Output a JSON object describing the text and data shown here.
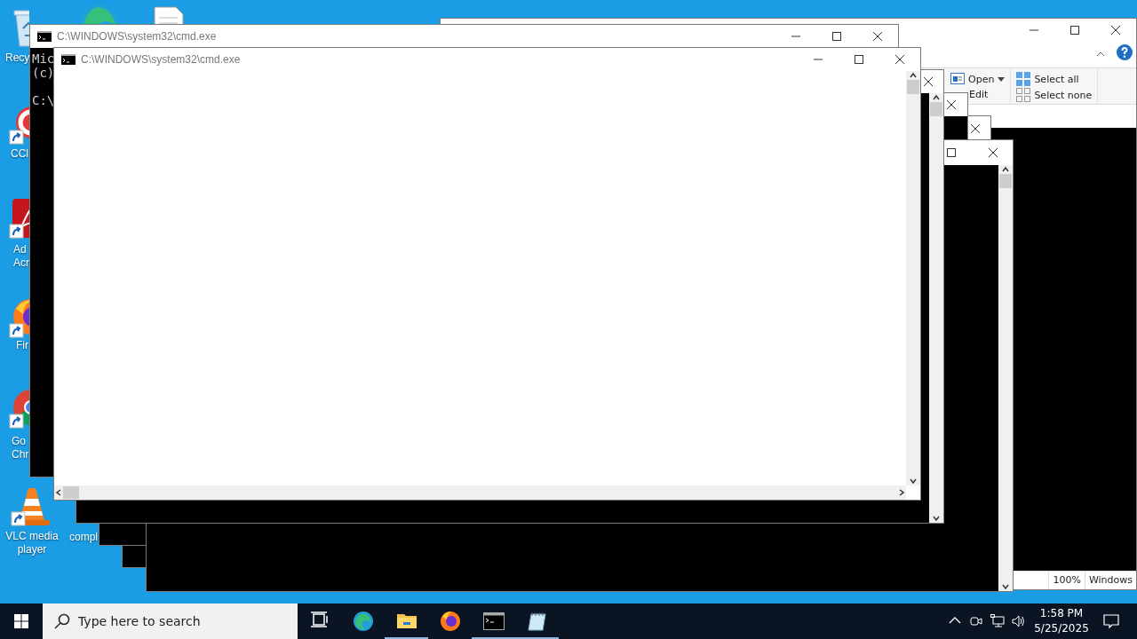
{
  "desktop": {
    "icons": [
      {
        "kind": "recycle",
        "shortcut": false,
        "lines": [
          "Recy"
        ]
      },
      {
        "kind": "edge"
      },
      {
        "kind": "document"
      },
      {
        "kind": "ccleaner",
        "shortcut": true,
        "lines": [
          "CCl"
        ]
      },
      {
        "kind": "acrobat",
        "shortcut": true,
        "lines": [
          "Ad",
          "Acr"
        ]
      },
      {
        "kind": "firefox",
        "shortcut": true,
        "lines": [
          "Fir"
        ]
      },
      {
        "kind": "chrome",
        "shortcut": true,
        "lines": [
          "Go",
          "Chr"
        ]
      },
      {
        "kind": "vlc",
        "shortcut": true,
        "lines": [
          "VLC media",
          "player"
        ]
      },
      {
        "kind": "label",
        "lines": [
          "compl"
        ]
      }
    ]
  },
  "windows": [
    {
      "kind": "explorer",
      "controls": [
        {
          "kind": "minimize"
        },
        {
          "kind": "maximize"
        },
        {
          "kind": "close"
        }
      ],
      "ribbon": [
        {
          "kind": "open",
          "label": "Open",
          "dropdown": true
        },
        {
          "kind": "edit",
          "label": "Edit",
          "dropdown": false
        },
        {
          "kind": "select-all",
          "label": "Select all",
          "dropdown": false
        },
        {
          "kind": "select-none",
          "label": "Select none",
          "dropdown": false
        }
      ],
      "status": [
        "100%",
        "Windows"
      ]
    },
    {
      "kind": "console",
      "dark": true,
      "controls": [
        {
          "kind": "close"
        }
      ]
    },
    {
      "kind": "console",
      "dark": true,
      "controls": [
        {
          "kind": "close"
        }
      ]
    },
    {
      "kind": "console",
      "dark": true,
      "controls": [
        {
          "kind": "maximize"
        },
        {
          "kind": "close"
        }
      ],
      "scrollbars": [
        {
          "kind": "vertical"
        }
      ]
    },
    {
      "kind": "console",
      "dark": true,
      "controls": [
        {
          "kind": "close"
        }
      ],
      "scrollbars": [
        {
          "kind": "vertical"
        }
      ]
    },
    {
      "kind": "console",
      "dark": true,
      "title": "C:\\WINDOWS\\system32\\cmd.exe",
      "controls": [
        {
          "kind": "minimize"
        },
        {
          "kind": "maximize"
        },
        {
          "kind": "close"
        }
      ],
      "paragraphs": [
        [
          "Mic",
          "(c)"
        ],
        [
          "C:\\"
        ]
      ]
    },
    {
      "kind": "console",
      "dark": false,
      "title": "C:\\WINDOWS\\system32\\cmd.exe",
      "controls": [
        {
          "kind": "minimize"
        },
        {
          "kind": "maximize"
        },
        {
          "kind": "close"
        }
      ],
      "scrollbars": [
        {
          "kind": "vertical"
        },
        {
          "kind": "horizontal"
        }
      ]
    }
  ],
  "taskbar": {
    "search": {
      "placeholder": "Type here to search"
    },
    "apps": [
      {
        "kind": "task-view",
        "running": false
      },
      {
        "kind": "edge",
        "running": false
      },
      {
        "kind": "folder",
        "running": true
      },
      {
        "kind": "firefox",
        "running": false
      },
      {
        "kind": "console",
        "running": true
      },
      {
        "kind": "notepad",
        "running": true
      }
    ],
    "tray": [
      {
        "kind": "chevron"
      },
      {
        "kind": "meet"
      },
      {
        "kind": "network"
      },
      {
        "kind": "volume"
      }
    ],
    "clock": {
      "time": "1:58 PM",
      "date": "5/25/2025"
    }
  }
}
